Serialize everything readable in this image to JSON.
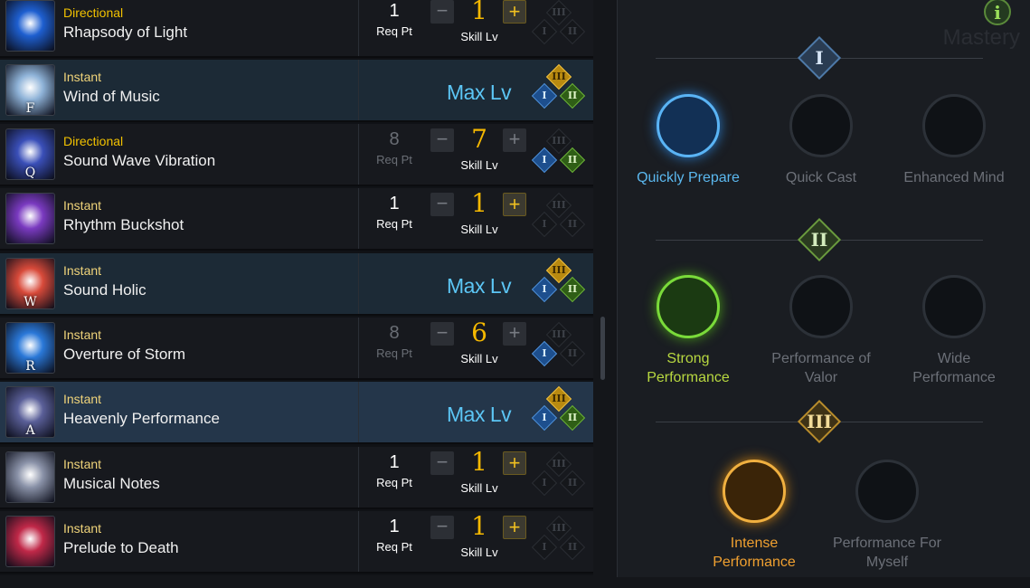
{
  "skills": [
    {
      "key": "",
      "type": "Directional",
      "name": "Rhapsody of Light",
      "state": "normal",
      "req_pt": "1",
      "req_lbl": "Req Pt",
      "level": "1",
      "lvl_lbl": "Skill Lv",
      "plus_enabled": true,
      "tripods": {
        "t1": false,
        "t2": false,
        "t3": false
      },
      "icon_color": "#1e5fd0"
    },
    {
      "key": "F",
      "type": "Instant",
      "name": "Wind of Music",
      "state": "maxed",
      "max_label": "Max Lv",
      "tripods": {
        "t1": true,
        "t2": true,
        "t3": true
      },
      "icon_color": "#8fb3d8"
    },
    {
      "key": "Q",
      "type": "Directional",
      "name": "Sound Wave Vibration",
      "state": "normal",
      "req_pt": "8",
      "req_lbl": "Req Pt",
      "req_dim": true,
      "level": "7",
      "lvl_lbl": "Skill Lv",
      "plus_enabled": false,
      "tripods": {
        "t1": true,
        "t2": true,
        "t3": false
      },
      "icon_color": "#3a4fb8"
    },
    {
      "key": "",
      "type": "Instant",
      "name": "Rhythm Buckshot",
      "state": "normal",
      "req_pt": "1",
      "req_lbl": "Req Pt",
      "level": "1",
      "lvl_lbl": "Skill Lv",
      "plus_enabled": true,
      "tripods": {
        "t1": false,
        "t2": false,
        "t3": false
      },
      "icon_color": "#7a3ac0"
    },
    {
      "key": "W",
      "type": "Instant",
      "name": "Sound Holic",
      "state": "maxed",
      "max_label": "Max Lv",
      "tripods": {
        "t1": true,
        "t2": true,
        "t3": true
      },
      "icon_color": "#d84a3a"
    },
    {
      "key": "R",
      "type": "Instant",
      "name": "Overture of Storm",
      "state": "normal",
      "req_pt": "8",
      "req_lbl": "Req Pt",
      "req_dim": true,
      "level": "6",
      "lvl_lbl": "Skill Lv",
      "plus_enabled": false,
      "tripods": {
        "t1": true,
        "t2": false,
        "t3": false
      },
      "icon_color": "#2a78d8"
    },
    {
      "key": "A",
      "type": "Instant",
      "name": "Heavenly Performance",
      "state": "selected",
      "max_label": "Max Lv",
      "tripods": {
        "t1": true,
        "t2": true,
        "t3": true
      },
      "icon_color": "#5a5f98"
    },
    {
      "key": "",
      "type": "Instant",
      "name": "Musical Notes",
      "state": "normal",
      "req_pt": "1",
      "req_lbl": "Req Pt",
      "level": "1",
      "lvl_lbl": "Skill Lv",
      "plus_enabled": true,
      "tripods": {
        "t1": false,
        "t2": false,
        "t3": false
      },
      "icon_color": "#8a92a8"
    },
    {
      "key": "",
      "type": "Instant",
      "name": "Prelude to Death",
      "state": "normal",
      "req_pt": "1",
      "req_lbl": "Req Pt",
      "level": "1",
      "lvl_lbl": "Skill Lv",
      "plus_enabled": true,
      "tripods": {
        "t1": false,
        "t2": false,
        "t3": false
      },
      "icon_color": "#c02848"
    }
  ],
  "tripod_numerals": {
    "t1": "I",
    "t2": "II",
    "t3": "III"
  },
  "mastery": {
    "bg_hint": "Mastery",
    "info_label": "i",
    "tiers": [
      {
        "numeral": "I",
        "style": "blue",
        "nodes": [
          {
            "label": "Quickly Prepare",
            "active": true
          },
          {
            "label": "Quick Cast",
            "active": false
          },
          {
            "label": "Enhanced Mind",
            "active": false
          }
        ]
      },
      {
        "numeral": "II",
        "style": "green",
        "nodes": [
          {
            "label": "Strong Performance",
            "active": true
          },
          {
            "label": "Performance of Valor",
            "active": false
          },
          {
            "label": "Wide Performance",
            "active": false
          }
        ]
      },
      {
        "numeral": "III",
        "style": "gold",
        "nodes": [
          {
            "label": "Intense Performance",
            "active": true
          },
          {
            "label": "Performance For Myself",
            "active": false
          }
        ]
      }
    ]
  }
}
